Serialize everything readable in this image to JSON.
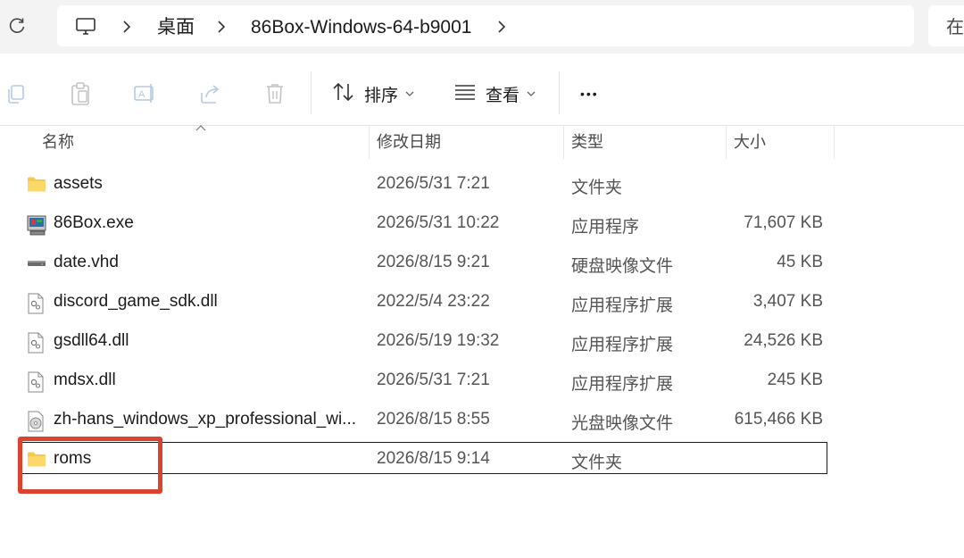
{
  "address_bar": {
    "crumbs": [
      "桌面",
      "86Box-Windows-64-b9001"
    ],
    "search_partial": "在"
  },
  "toolbar": {
    "sort_label": "排序",
    "view_label": "查看",
    "more_label": "•••"
  },
  "columns": {
    "name": "名称",
    "modified": "修改日期",
    "type": "类型",
    "size": "大小"
  },
  "files": [
    {
      "name": "assets",
      "modified": "2026/5/31 7:21",
      "type": "文件夹",
      "size": "",
      "icon": "folder-icon"
    },
    {
      "name": "86Box.exe",
      "modified": "2026/5/31 10:22",
      "type": "应用程序",
      "size": "71,607 KB",
      "icon": "application-icon"
    },
    {
      "name": "date.vhd",
      "modified": "2026/8/15 9:21",
      "type": "硬盘映像文件",
      "size": "45 KB",
      "icon": "disk-image-icon"
    },
    {
      "name": "discord_game_sdk.dll",
      "modified": "2022/5/4 23:22",
      "type": "应用程序扩展",
      "size": "3,407 KB",
      "icon": "dll-icon"
    },
    {
      "name": "gsdll64.dll",
      "modified": "2026/5/19 19:32",
      "type": "应用程序扩展",
      "size": "24,526 KB",
      "icon": "dll-icon"
    },
    {
      "name": "mdsx.dll",
      "modified": "2026/5/31 7:21",
      "type": "应用程序扩展",
      "size": "245 KB",
      "icon": "dll-icon"
    },
    {
      "name": "zh-hans_windows_xp_professional_wi...",
      "modified": "2026/8/15 8:55",
      "type": "光盘映像文件",
      "size": "615,466 KB",
      "icon": "disc-image-icon"
    },
    {
      "name": "roms",
      "modified": "2026/8/15 9:14",
      "type": "文件夹",
      "size": "",
      "icon": "folder-icon"
    }
  ],
  "colors": {
    "highlight_box": "#d9432f",
    "folder": "#f7c948"
  }
}
